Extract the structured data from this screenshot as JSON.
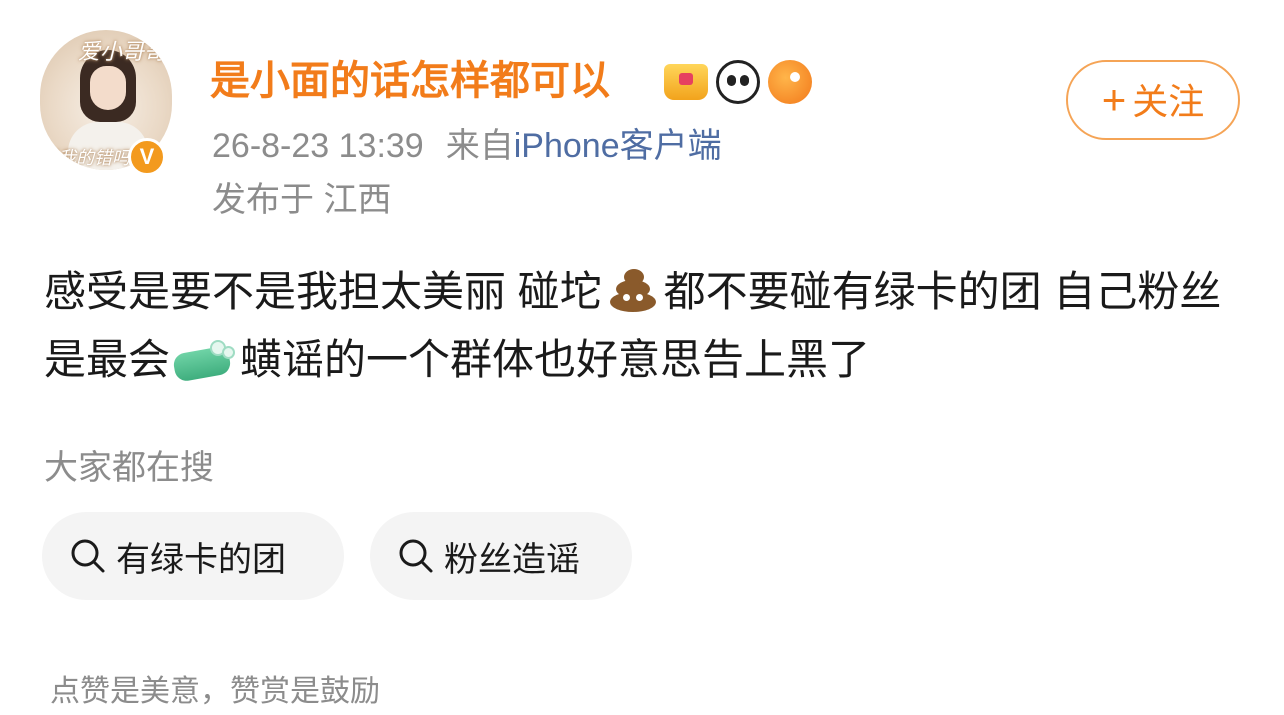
{
  "header": {
    "avatar": {
      "script_top": "爱小哥哥",
      "script_bottom": "是我的错吗",
      "verified_mark": "V"
    },
    "user_name": "是小面的话怎样都可以",
    "badges": [
      "crown-icon",
      "panda-icon",
      "fish-icon"
    ],
    "timestamp": "26-8-23 13:39",
    "source_prefix": "来自",
    "source_device": "iPhone客户端",
    "location": "发布于 江西",
    "follow": {
      "plus": "+",
      "label": "关注"
    }
  },
  "post": {
    "segment_1": "感受是要不是我担太美丽 碰坨",
    "emoji_1": "poop-emoji",
    "segment_2": "都不要碰有绿卡的团 自己粉丝是最会",
    "emoji_2": "soap-emoji",
    "segment_3": "蟥谣的一个群体也好意思告上黑了"
  },
  "search": {
    "heading": "大家都在搜",
    "chips": [
      {
        "label": "有绿卡的团"
      },
      {
        "label": "粉丝造谣"
      }
    ]
  },
  "footer": {
    "note": "点赞是美意，赞赏是鼓励"
  },
  "colors": {
    "name_orange": "#f27c1a",
    "meta_gray": "#8c8c8c",
    "source_blue": "#4f6da3",
    "chip_bg": "#f4f4f4",
    "follow_border": "#f5a456"
  }
}
